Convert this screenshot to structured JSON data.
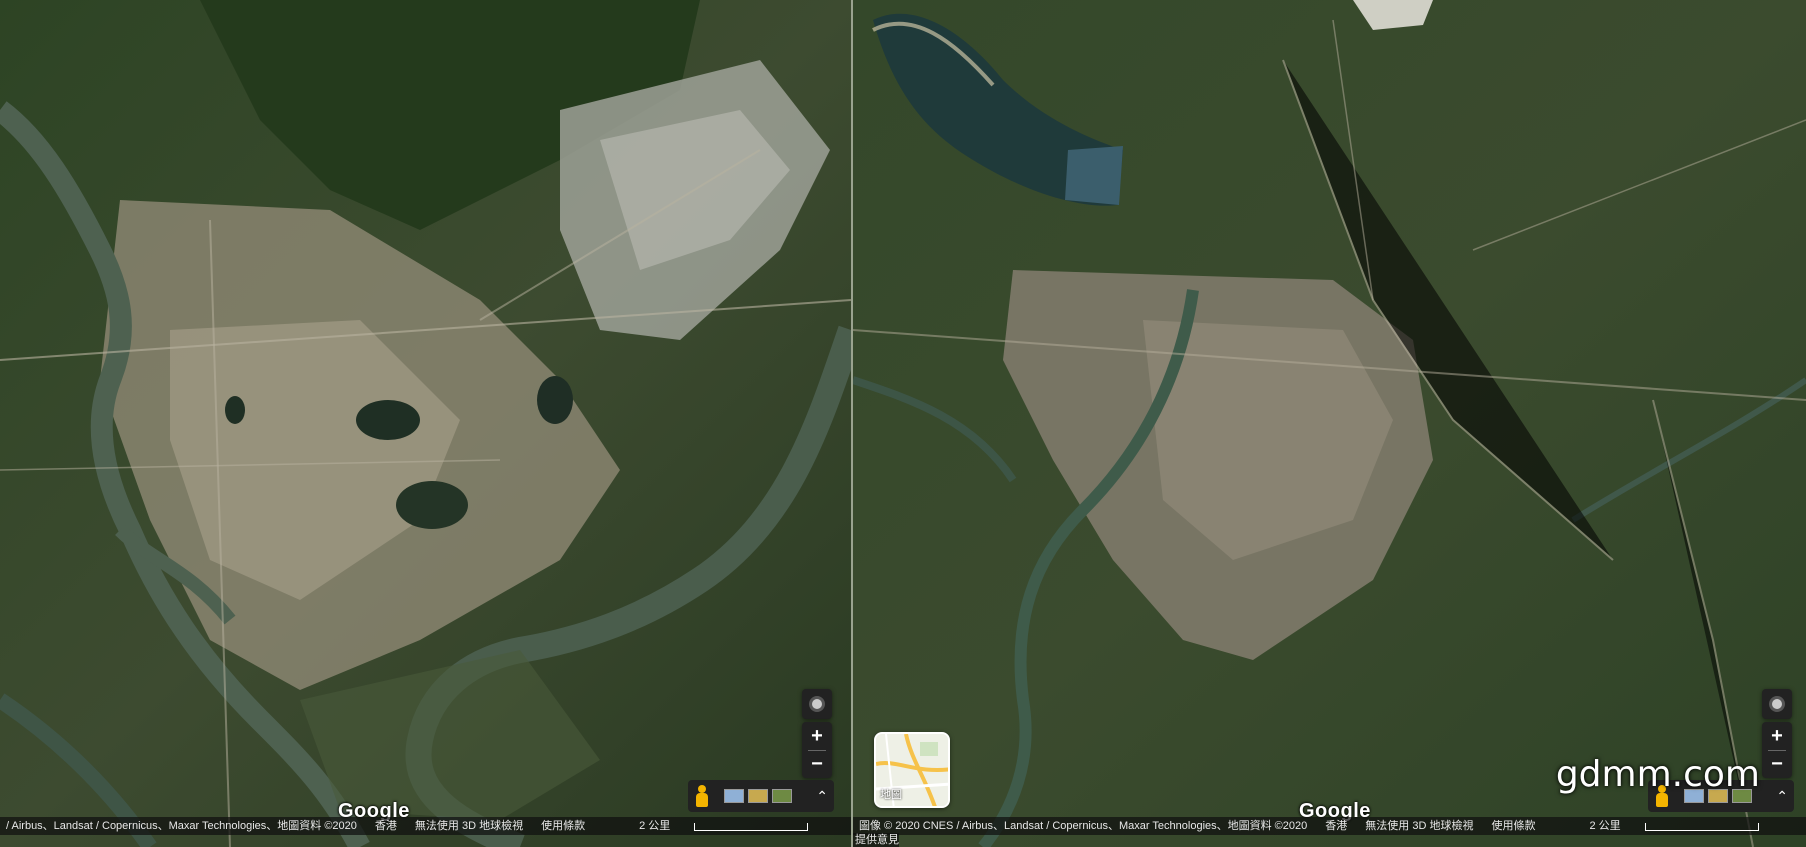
{
  "left_map": {
    "logo": "Google",
    "attribution": "/ Airbus、Landsat / Copernicus、Maxar Technologies、地圖資料 ©2020",
    "region": "香港",
    "no_3d": "無法使用 3D 地球檢視",
    "terms": "使用條款",
    "scale_label": "2 公里"
  },
  "right_map": {
    "logo": "Google",
    "attribution": "圖像 © 2020 CNES / Airbus、Landsat / Copernicus、Maxar Technologies、地圖資料 ©2020",
    "region": "香港",
    "no_3d": "無法使用 3D 地球檢視",
    "terms": "使用條款",
    "scale_label": "2 公里",
    "feedback": "提供意見",
    "map_toggle_label": "地圖"
  },
  "controls": {
    "zoom_in": "+",
    "zoom_out": "−",
    "expand": "⌃"
  },
  "watermark": "gdmm.com",
  "icons": {
    "locate": "my-location-icon",
    "pegman": "street-view-pegman-icon",
    "expand": "chevron-up-icon"
  }
}
